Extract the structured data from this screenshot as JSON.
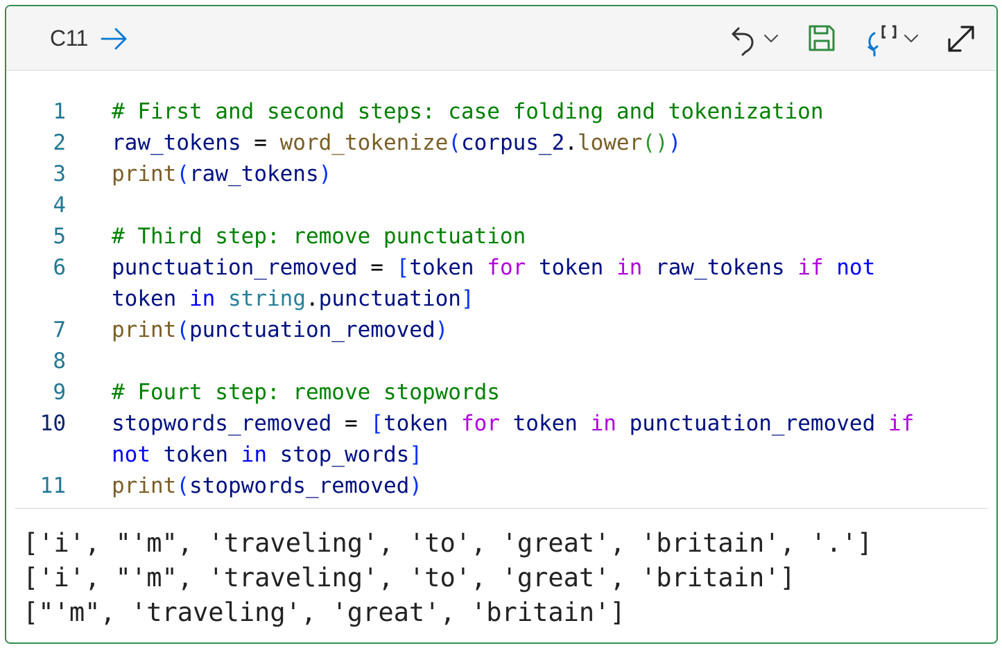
{
  "header": {
    "cell_ref": "C11",
    "icons": [
      "run-arrow-icon",
      "undo-icon",
      "chevron-down-icon",
      "save-icon",
      "reference-icon",
      "chevron-down-icon",
      "expand-icon"
    ],
    "colors": {
      "accent": "#0078d4",
      "save": "#2e8b3e",
      "border": "#2f8f4f"
    }
  },
  "code": {
    "lines": [
      {
        "num": "1",
        "tokens": [
          {
            "t": "# First and second steps: case folding and tokenization",
            "c": "cm"
          }
        ]
      },
      {
        "num": "2",
        "tokens": [
          {
            "t": "raw_tokens",
            "c": "vr"
          },
          {
            "t": " = ",
            "c": "pl"
          },
          {
            "t": "word_tokenize",
            "c": "fn"
          },
          {
            "t": "(",
            "c": "b1"
          },
          {
            "t": "corpus_2",
            "c": "vr"
          },
          {
            "t": ".",
            "c": "pl"
          },
          {
            "t": "lower",
            "c": "fn"
          },
          {
            "t": "()",
            "c": "b2"
          },
          {
            "t": ")",
            "c": "b1"
          }
        ]
      },
      {
        "num": "3",
        "tokens": [
          {
            "t": "print",
            "c": "fn"
          },
          {
            "t": "(",
            "c": "b1"
          },
          {
            "t": "raw_tokens",
            "c": "vr"
          },
          {
            "t": ")",
            "c": "b1"
          }
        ]
      },
      {
        "num": "4",
        "tokens": []
      },
      {
        "num": "5",
        "tokens": [
          {
            "t": "# Third step: remove punctuation",
            "c": "cm"
          }
        ]
      },
      {
        "num": "6",
        "tokens": [
          {
            "t": "punctuation_removed",
            "c": "vr"
          },
          {
            "t": " = ",
            "c": "pl"
          },
          {
            "t": "[",
            "c": "b1"
          },
          {
            "t": "token",
            "c": "vr"
          },
          {
            "t": " ",
            "c": "pl"
          },
          {
            "t": "for",
            "c": "kw"
          },
          {
            "t": " ",
            "c": "pl"
          },
          {
            "t": "token",
            "c": "vr"
          },
          {
            "t": " ",
            "c": "pl"
          },
          {
            "t": "in",
            "c": "kw"
          },
          {
            "t": " ",
            "c": "pl"
          },
          {
            "t": "raw_tokens",
            "c": "vr"
          },
          {
            "t": " ",
            "c": "pl"
          },
          {
            "t": "if",
            "c": "kw"
          },
          {
            "t": " ",
            "c": "pl"
          },
          {
            "t": "not",
            "c": "kb"
          }
        ]
      },
      {
        "num": "",
        "tokens": [
          {
            "t": "token",
            "c": "vr"
          },
          {
            "t": " ",
            "c": "pl"
          },
          {
            "t": "in",
            "c": "kb"
          },
          {
            "t": " ",
            "c": "pl"
          },
          {
            "t": "string",
            "c": "mod"
          },
          {
            "t": ".",
            "c": "pl"
          },
          {
            "t": "punctuation",
            "c": "vr"
          },
          {
            "t": "]",
            "c": "b1"
          }
        ]
      },
      {
        "num": "7",
        "tokens": [
          {
            "t": "print",
            "c": "fn"
          },
          {
            "t": "(",
            "c": "b1"
          },
          {
            "t": "punctuation_removed",
            "c": "vr"
          },
          {
            "t": ")",
            "c": "b1"
          }
        ]
      },
      {
        "num": "8",
        "tokens": []
      },
      {
        "num": "9",
        "tokens": [
          {
            "t": "# Fourt step: remove stopwords",
            "c": "cm"
          }
        ]
      },
      {
        "num": "10",
        "current": true,
        "tokens": [
          {
            "t": "stopwords_removed",
            "c": "vr"
          },
          {
            "t": " = ",
            "c": "pl"
          },
          {
            "t": "[",
            "c": "b1"
          },
          {
            "t": "token",
            "c": "vr"
          },
          {
            "t": " ",
            "c": "pl"
          },
          {
            "t": "for",
            "c": "kw"
          },
          {
            "t": " ",
            "c": "pl"
          },
          {
            "t": "token",
            "c": "vr"
          },
          {
            "t": " ",
            "c": "pl"
          },
          {
            "t": "in",
            "c": "kw"
          },
          {
            "t": " ",
            "c": "pl"
          },
          {
            "t": "punctuation_removed",
            "c": "vr"
          },
          {
            "t": " ",
            "c": "pl"
          },
          {
            "t": "if",
            "c": "kw"
          }
        ]
      },
      {
        "num": "",
        "tokens": [
          {
            "t": "not",
            "c": "kb"
          },
          {
            "t": " ",
            "c": "pl"
          },
          {
            "t": "token",
            "c": "vr"
          },
          {
            "t": " ",
            "c": "pl"
          },
          {
            "t": "in",
            "c": "kb"
          },
          {
            "t": " ",
            "c": "pl"
          },
          {
            "t": "stop_words",
            "c": "vr"
          },
          {
            "t": "]",
            "c": "b1"
          }
        ]
      },
      {
        "num": "11",
        "tokens": [
          {
            "t": "print",
            "c": "fn"
          },
          {
            "t": "(",
            "c": "b1"
          },
          {
            "t": "stopwords_removed",
            "c": "vr"
          },
          {
            "t": ")",
            "c": "b1"
          }
        ]
      }
    ]
  },
  "output": {
    "lines": [
      "['i', \"'m\", 'traveling', 'to', 'great', 'britain', '.']",
      "['i', \"'m\", 'traveling', 'to', 'great', 'britain']",
      "[\"'m\", 'traveling', 'great', 'britain']"
    ]
  }
}
